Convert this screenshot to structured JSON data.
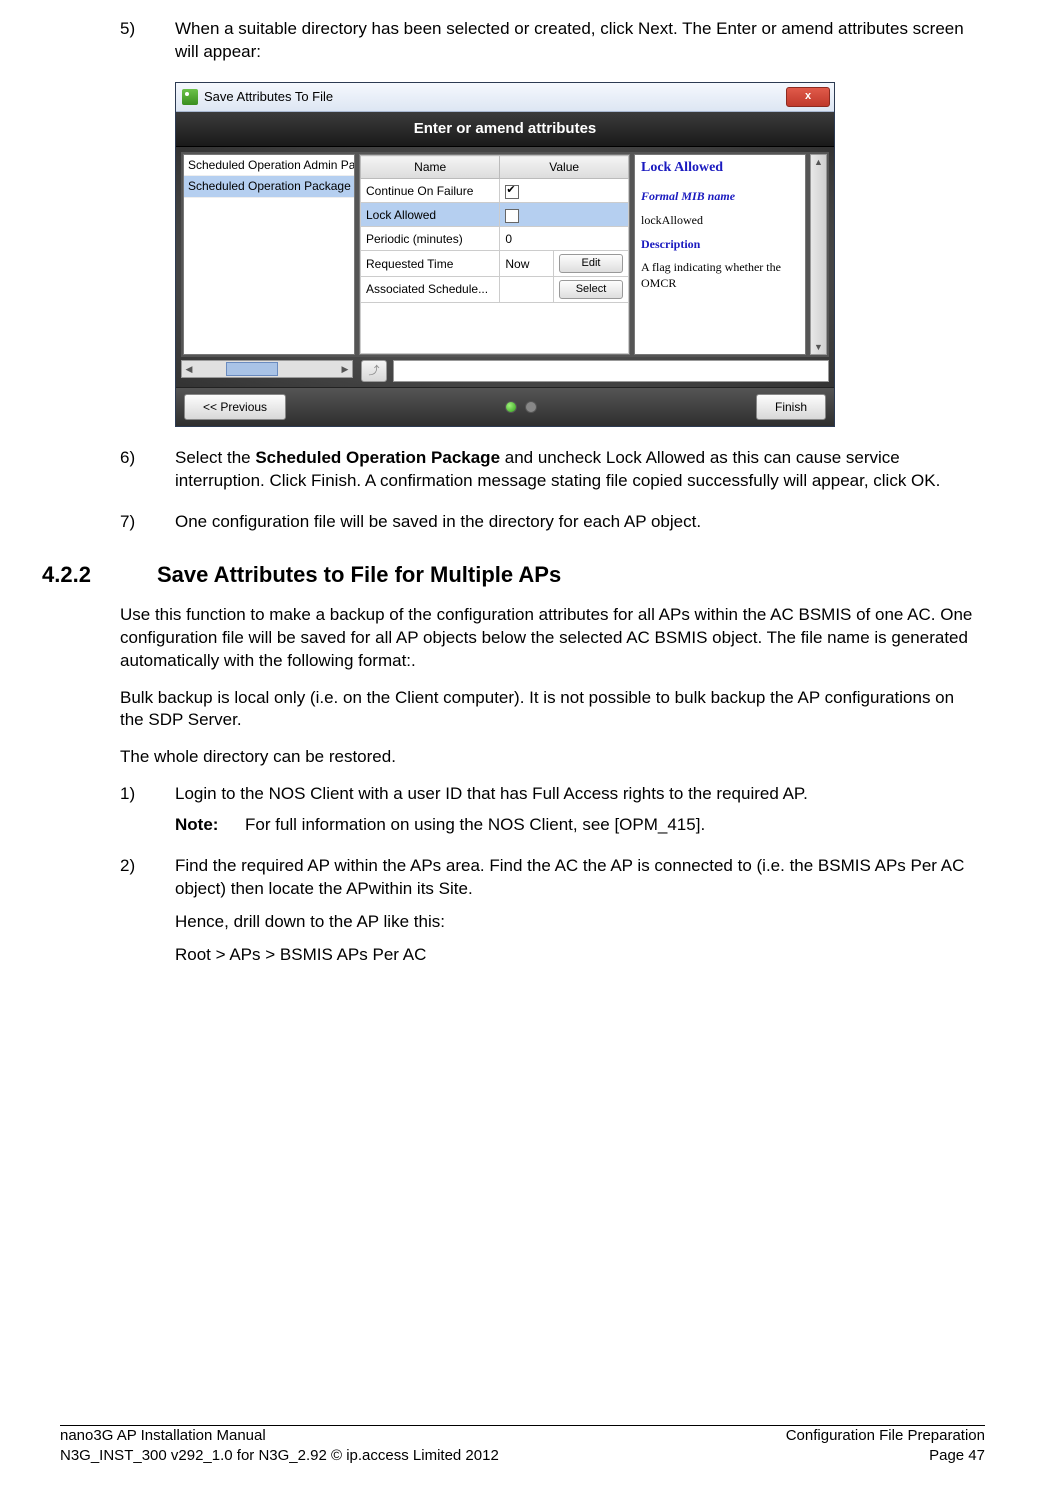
{
  "steps": {
    "s5": {
      "num": "5)",
      "text": " When a suitable directory has been selected or created, click Next. The Enter or amend attributes screen will appear:"
    },
    "s6": {
      "num": "6)",
      "prefix": "Select the ",
      "bold": "Scheduled Operation Package",
      "suffix": " and uncheck Lock Allowed as this can cause service interruption. Click Finish. A confirmation message stating file copied successfully will appear, click OK."
    },
    "s7": {
      "num": "7)",
      "text": "One configuration file will be saved in the directory for each AP object."
    }
  },
  "section": {
    "num": "4.2.2",
    "title": "Save Attributes to File for Multiple APs",
    "p1": "Use this function to make a backup of the configuration attributes for all APs within the AC BSMIS of one AC. One configuration file will be saved for all AP objects below the selected AC BSMIS object. The file name is generated automatically with the following format:.",
    "p2": "Bulk backup is local only (i.e. on the Client computer). It is not possible to bulk backup the AP configurations on the SDP Server.",
    "p3": "The whole directory can be restored.",
    "step1": {
      "num": "1)",
      "text": "Login to the NOS Client with a user ID that has Full Access rights to the required AP.",
      "note_label": "Note:",
      "note": "For full information on using the NOS Client, see [OPM_415]."
    },
    "step2": {
      "num": "2)",
      "text": "Find the required AP within the APs area. Find the AC the AP is connected to (i.e. the BSMIS APs Per AC object) then locate the APwithin its Site.",
      "sub1": "Hence, drill down to the AP like this:",
      "sub2": "Root > APs > BSMIS APs Per AC"
    }
  },
  "dialog": {
    "title": "Save Attributes To File",
    "close": "x",
    "banner": "Enter or amend attributes",
    "list": {
      "item0": "Scheduled Operation Admin Pac",
      "item1": "Scheduled Operation Package"
    },
    "headers": {
      "name": "Name",
      "value": "Value"
    },
    "rows": {
      "r0": {
        "name": "Continue On Failure",
        "checked": true
      },
      "r1": {
        "name": "Lock Allowed",
        "checked": false
      },
      "r2": {
        "name": "Periodic (minutes)",
        "value": "0"
      },
      "r3": {
        "name": "Requested Time",
        "value": "Now",
        "btn": "Edit"
      },
      "r4": {
        "name": "Associated Schedule...",
        "btn": "Select"
      }
    },
    "desc": {
      "h1": "Lock Allowed",
      "h2": "Formal MIB name",
      "mib": "lockAllowed",
      "h3": "Description",
      "body": "A flag indicating whether the OMCR"
    },
    "up_glyph": "⤴",
    "footer": {
      "prev": "<< Previous",
      "finish": "Finish"
    }
  },
  "footer": {
    "left1": "nano3G AP Installation Manual",
    "right1": "Configuration File Preparation",
    "left2": "N3G_INST_300 v292_1.0 for N3G_2.92 © ip.access Limited 2012",
    "right2": "Page 47"
  }
}
